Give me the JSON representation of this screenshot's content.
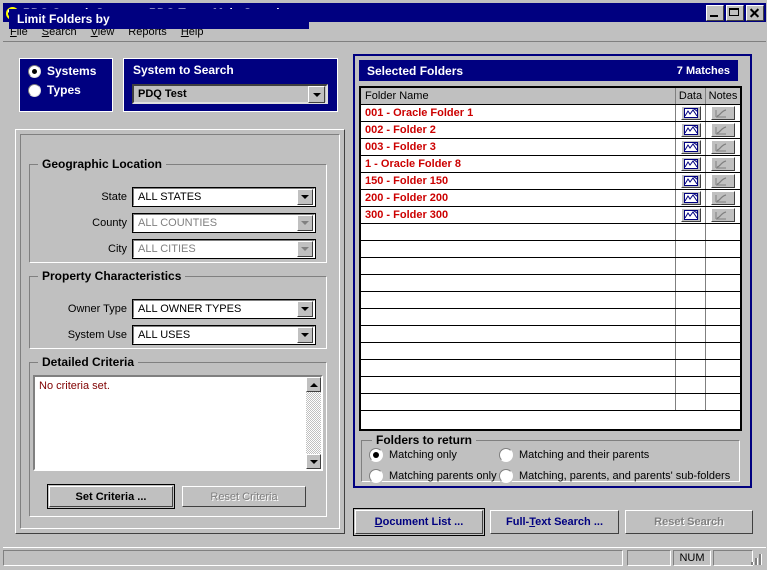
{
  "window": {
    "title": "PDQ Search System - PDQ Test - Main Search",
    "icon": "app-magnifier-icon",
    "minimize_label": "_",
    "maximize_label": "□",
    "close_label": "×"
  },
  "menu": {
    "items": [
      {
        "label": "File",
        "accel": "F"
      },
      {
        "label": "Search",
        "accel": "S"
      },
      {
        "label": "View",
        "accel": "V"
      },
      {
        "label": "Reports",
        "accel": ""
      },
      {
        "label": "Help",
        "accel": "H"
      }
    ]
  },
  "scope_panel": {
    "options": [
      {
        "label": "Systems",
        "selected": true
      },
      {
        "label": "Types",
        "selected": false
      }
    ]
  },
  "system_panel": {
    "title": "System to Search",
    "combo_value": "PDQ Test"
  },
  "limit_folders": {
    "title": "Limit Folders by",
    "geographic": {
      "caption": "Geographic Location",
      "fields": [
        {
          "label": "State",
          "value": "ALL STATES",
          "enabled": true
        },
        {
          "label": "County",
          "value": "ALL COUNTIES",
          "enabled": false
        },
        {
          "label": "City",
          "value": "ALL CITIES",
          "enabled": false
        }
      ]
    },
    "property": {
      "caption": "Property Characteristics",
      "fields": [
        {
          "label": "Owner Type",
          "value": "ALL OWNER TYPES",
          "enabled": true
        },
        {
          "label": "System Use",
          "value": "ALL USES",
          "enabled": true
        }
      ]
    },
    "detailed": {
      "caption": "Detailed Criteria",
      "text": "No criteria set.",
      "text_color": "#800000",
      "set_button": "Set Criteria ...",
      "reset_button": "Reset Criteria",
      "reset_enabled": false
    }
  },
  "selected_folders": {
    "header_title": "Selected Folders",
    "match_count": "7 Matches",
    "columns": [
      "Folder Name",
      "Data",
      "Notes"
    ],
    "rows": [
      {
        "name": "001 - Oracle Folder 1",
        "data_icon": "data-sheet-icon",
        "notes_icon": "notes-pencil-icon"
      },
      {
        "name": "002 - Folder 2",
        "data_icon": "data-sheet-icon",
        "notes_icon": "notes-pencil-icon"
      },
      {
        "name": "003 - Folder 3",
        "data_icon": "data-sheet-icon",
        "notes_icon": "notes-pencil-icon"
      },
      {
        "name": "1 - Oracle Folder 8",
        "data_icon": "data-sheet-icon",
        "notes_icon": "notes-pencil-icon"
      },
      {
        "name": "150 - Folder 150",
        "data_icon": "data-sheet-icon",
        "notes_icon": "notes-pencil-icon"
      },
      {
        "name": "200 - Folder 200",
        "data_icon": "data-sheet-icon",
        "notes_icon": "notes-pencil-icon"
      },
      {
        "name": "300 - Folder 300",
        "data_icon": "data-sheet-icon",
        "notes_icon": "notes-pencil-icon"
      }
    ],
    "empty_row_count": 11,
    "row_text_color": "#cc0000"
  },
  "folders_to_return": {
    "caption": "Folders to return",
    "options": [
      {
        "label": "Matching only",
        "selected": true
      },
      {
        "label": "Matching and their parents",
        "selected": false
      },
      {
        "label": "Matching parents only",
        "selected": false
      },
      {
        "label": "Matching, parents, and parents' sub-folders",
        "selected": false
      }
    ]
  },
  "actions": {
    "document_list": {
      "label": "Document List ...",
      "accel": "D",
      "enabled": true
    },
    "full_text_search": {
      "label": "Full-Text Search ...",
      "accel": "T",
      "enabled": true
    },
    "reset_search": {
      "label": "Reset Search",
      "accel": "",
      "enabled": false
    }
  },
  "status_bar": {
    "left": "",
    "panes": [
      "",
      "NUM",
      ""
    ]
  },
  "colors": {
    "title_blue": "#000080",
    "face": "#c0c0c0",
    "folder_red": "#cc0000",
    "criteria_maroon": "#800000",
    "button_text_blue": "#000080"
  }
}
